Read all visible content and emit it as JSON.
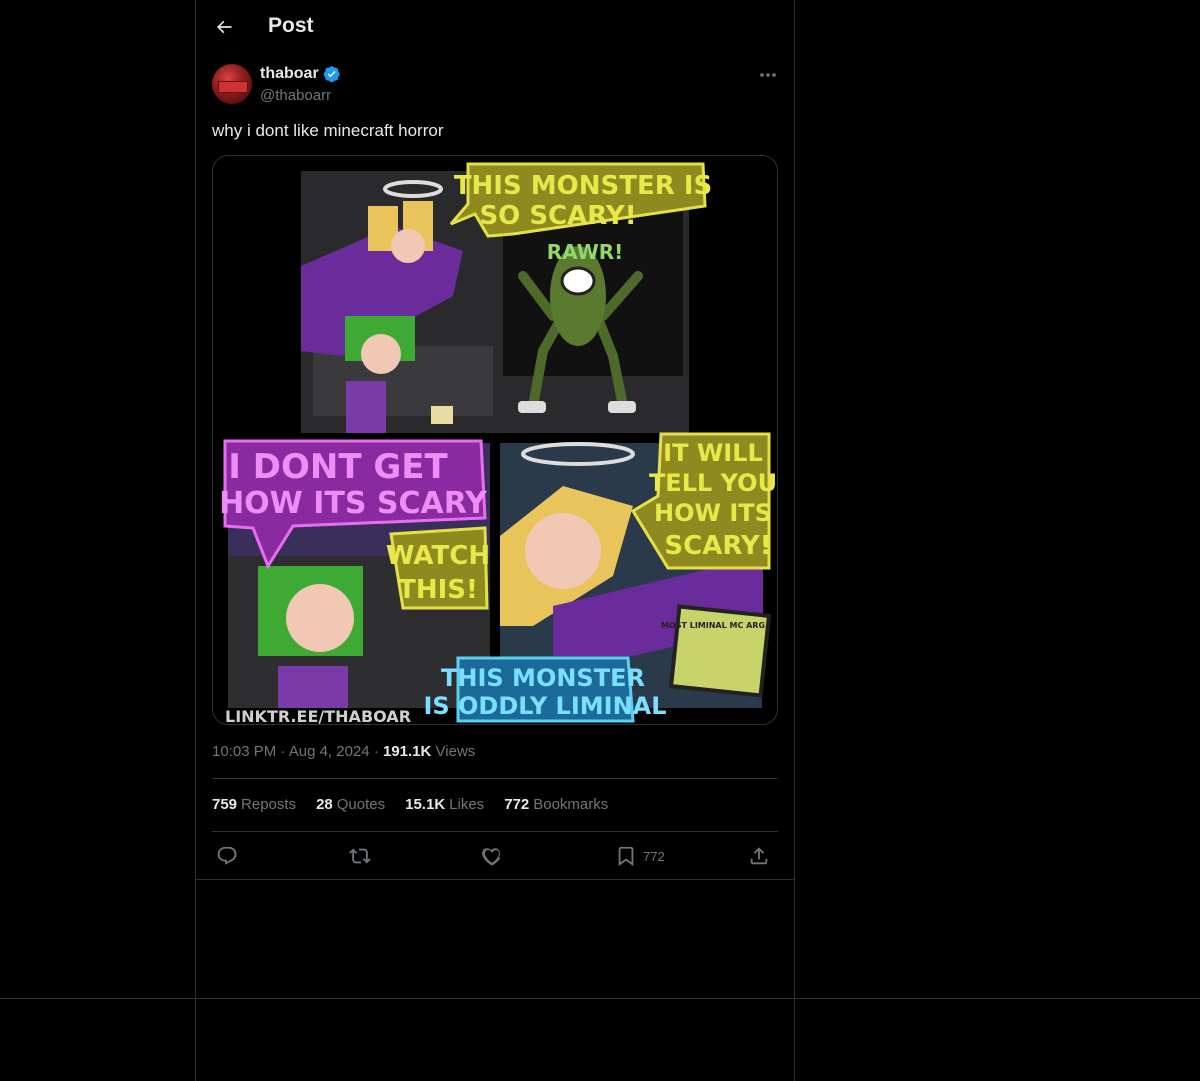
{
  "header": {
    "title": "Post"
  },
  "author": {
    "name": "thaboar",
    "handle": "@thaboarr"
  },
  "post": {
    "text": "why i dont like minecraft horror"
  },
  "comic": {
    "bubble1": [
      "THIS MONSTER IS",
      "SO SCARY!"
    ],
    "rawr": "RAWR!",
    "bubble2": [
      "I DONT GET",
      "HOW ITS SCARY"
    ],
    "watch": [
      "WATCH",
      "THIS!"
    ],
    "bubble3": [
      "IT WILL",
      "TELL YOU",
      "HOW ITS",
      "SCARY!"
    ],
    "bubble4": [
      "THIS MONSTER",
      "IS ODDLY LIMINAL"
    ],
    "screen_label": "MOST LIMINAL MC ARG",
    "credit": "LINKTR.EE/THABOAR"
  },
  "meta": {
    "time": "10:03 PM",
    "date": "Aug 4, 2024",
    "views_count": "191.1K",
    "views_label": "Views"
  },
  "stats": {
    "reposts_count": "759",
    "reposts_label": "Reposts",
    "quotes_count": "28",
    "quotes_label": "Quotes",
    "likes_count": "15.1K",
    "likes_label": "Likes",
    "bookmarks_count": "772",
    "bookmarks_label": "Bookmarks"
  },
  "actions": {
    "bookmark_count": "772"
  },
  "colors": {
    "background": "#000000",
    "text": "#e7e9ea",
    "muted": "#71767b",
    "border": "#2f3336",
    "verified": "#1d9bf0"
  }
}
